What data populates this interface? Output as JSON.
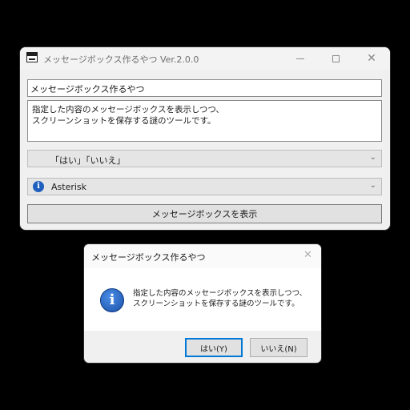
{
  "main_window": {
    "title": "メッセージボックス作るやつ Ver.2.0.0",
    "title_input_value": "メッセージボックス作るやつ",
    "message_lines": [
      "指定した内容のメッセージボックスを表示しつつ、",
      "スクリーンショットを保存する謎のツールです。"
    ],
    "buttons_combo_value": "「はい」「いいえ」",
    "icon_combo_value": "Asterisk",
    "icon_combo_icon": "info-icon",
    "show_button_label": "メッセージボックスを表示"
  },
  "message_box": {
    "title": "メッセージボックス作るやつ",
    "icon": "info-icon",
    "text_lines": [
      "指定した内容のメッセージボックスを表示しつつ、",
      "スクリーンショットを保存する謎のツールです。"
    ],
    "yes_label": "はい(Y)",
    "no_label": "いいえ(N)"
  },
  "colors": {
    "background": "#000000",
    "window": "#f0f0f0",
    "info_blue": "#1f5fbf",
    "focus_border": "#0078d7"
  }
}
